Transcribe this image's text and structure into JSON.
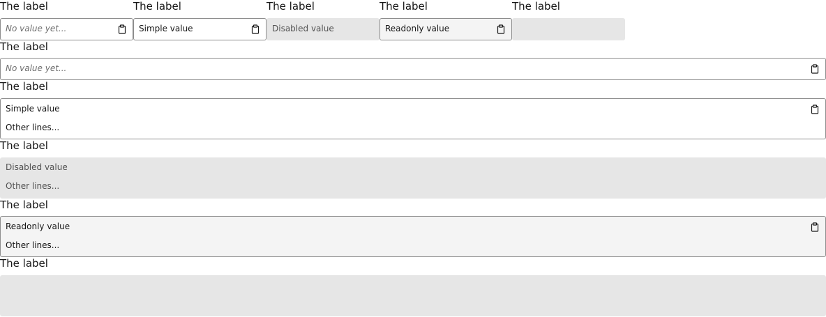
{
  "row1": [
    {
      "label": "The label",
      "value": "No value yet...",
      "state": "placeholder"
    },
    {
      "label": "The label",
      "value": "Simple value",
      "state": "normal"
    },
    {
      "label": "The label",
      "value": "Disabled value",
      "state": "disabled"
    },
    {
      "label": "The label",
      "value": "Readonly value",
      "state": "readonly"
    },
    {
      "label": "The label",
      "value": "",
      "state": "empty"
    }
  ],
  "wide_single": {
    "label": "The label",
    "value": "No value yet...",
    "state": "placeholder"
  },
  "multi_normal": {
    "label": "The label",
    "lines": [
      "Simple value",
      "Other lines..."
    ],
    "state": "normal"
  },
  "multi_disabled": {
    "label": "The label",
    "lines": [
      "Disabled value",
      "Other lines..."
    ],
    "state": "disabled"
  },
  "multi_readonly": {
    "label": "The label",
    "lines": [
      "Readonly value",
      "Other lines..."
    ],
    "state": "readonly"
  },
  "multi_empty": {
    "label": "The label",
    "lines": [],
    "state": "empty"
  },
  "icons": {
    "copy": "clipboard-icon"
  },
  "colors": {
    "border": "#8d8d8d",
    "disabled_bg": "#e6e6e6",
    "readonly_bg": "#f4f4f4",
    "placeholder_text": "#6f6f6f",
    "text": "#161616"
  }
}
